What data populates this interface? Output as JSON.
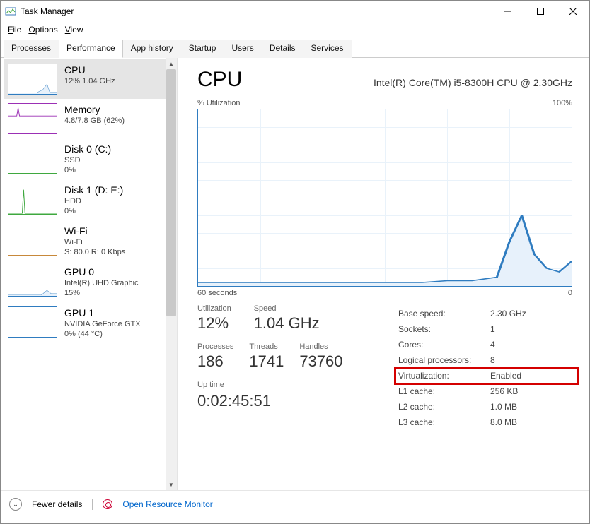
{
  "window": {
    "title": "Task Manager",
    "menu": {
      "file": "File",
      "options": "Options",
      "view": "View"
    }
  },
  "tabs": {
    "items": [
      "Processes",
      "Performance",
      "App history",
      "Startup",
      "Users",
      "Details",
      "Services"
    ],
    "active": 1
  },
  "sidebar": {
    "items": [
      {
        "title": "CPU",
        "line2": "12% 1.04 GHz",
        "line3": "",
        "color": "#2f7cc0"
      },
      {
        "title": "Memory",
        "line2": "4.8/7.8 GB (62%)",
        "line3": "",
        "color": "#9b2fb5"
      },
      {
        "title": "Disk 0 (C:)",
        "line2": "SSD",
        "line3": "0%",
        "color": "#3fa83f"
      },
      {
        "title": "Disk 1 (D: E:)",
        "line2": "HDD",
        "line3": "0%",
        "color": "#3fa83f"
      },
      {
        "title": "Wi-Fi",
        "line2": "Wi-Fi",
        "line3": "S: 80.0  R: 0 Kbps",
        "color": "#c7883a"
      },
      {
        "title": "GPU 0",
        "line2": "Intel(R) UHD Graphic",
        "line3": "15%",
        "color": "#2f7cc0"
      },
      {
        "title": "GPU 1",
        "line2": "NVIDIA GeForce GTX",
        "line3": "0% (44 °C)",
        "color": "#2f7cc0"
      }
    ],
    "selected": 0
  },
  "main": {
    "heading": "CPU",
    "model": "Intel(R) Core(TM) i5-8300H CPU @ 2.30GHz",
    "chart_top_left": "% Utilization",
    "chart_top_right": "100%",
    "chart_bottom_left": "60 seconds",
    "chart_bottom_right": "0",
    "stats": {
      "utilization": {
        "label": "Utilization",
        "value": "12%"
      },
      "speed": {
        "label": "Speed",
        "value": "1.04 GHz"
      },
      "processes": {
        "label": "Processes",
        "value": "186"
      },
      "threads": {
        "label": "Threads",
        "value": "1741"
      },
      "handles": {
        "label": "Handles",
        "value": "73760"
      },
      "uptime": {
        "label": "Up time",
        "value": "0:02:45:51"
      }
    },
    "specs": [
      {
        "k": "Base speed:",
        "v": "2.30 GHz"
      },
      {
        "k": "Sockets:",
        "v": "1"
      },
      {
        "k": "Cores:",
        "v": "4"
      },
      {
        "k": "Logical processors:",
        "v": "8"
      },
      {
        "k": "Virtualization:",
        "v": "Enabled",
        "highlight": true
      },
      {
        "k": "L1 cache:",
        "v": "256 KB"
      },
      {
        "k": "L2 cache:",
        "v": "1.0 MB"
      },
      {
        "k": "L3 cache:",
        "v": "8.0 MB"
      }
    ]
  },
  "footer": {
    "fewer": "Fewer details",
    "resmon": "Open Resource Monitor"
  },
  "chart_data": {
    "type": "line",
    "title": "% Utilization",
    "xlabel": "seconds",
    "ylabel": "% Utilization",
    "xlim": [
      60,
      0
    ],
    "ylim": [
      0,
      100
    ],
    "x": [
      60,
      56,
      52,
      48,
      44,
      40,
      36,
      32,
      28,
      24,
      20,
      16,
      12,
      10,
      8,
      6,
      4,
      2,
      0
    ],
    "values": [
      2,
      2,
      2,
      2,
      2,
      2,
      2,
      2,
      2,
      2,
      3,
      3,
      5,
      25,
      40,
      18,
      10,
      8,
      14
    ]
  }
}
